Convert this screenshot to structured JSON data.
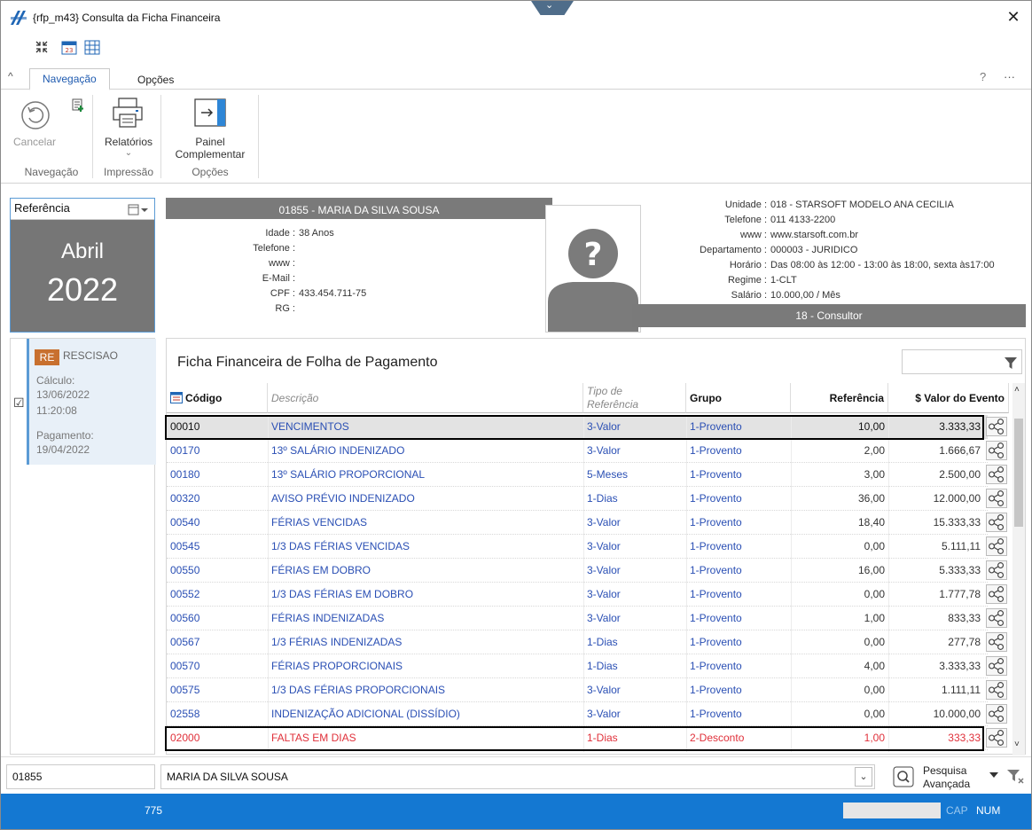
{
  "window": {
    "title": "{rfp_m43}  Consulta da Ficha Financeira",
    "close_glyph": "✕"
  },
  "ribbon": {
    "tabs": [
      {
        "label": "Navegação",
        "active": true
      },
      {
        "label": "Opções",
        "active": false
      }
    ],
    "help": "?",
    "more": "···",
    "buttons": {
      "cancel": "Cancelar",
      "reports": "Relatórios",
      "reports_arrow": "⌄",
      "panel_line1": "Painel",
      "panel_line2": "Complementar"
    },
    "groups": {
      "nav": "Navegação",
      "print": "Impressão",
      "options": "Opções"
    }
  },
  "reference": {
    "label": "Referência",
    "month": "Abril",
    "year": "2022"
  },
  "employee": {
    "header": "01855 - MARIA DA SILVA SOUSA",
    "left_labels": [
      "Idade :",
      "Telefone :",
      "www :",
      "E-Mail :",
      "CPF :",
      "RG :"
    ],
    "left_values": [
      "38 Anos",
      "",
      "",
      "",
      "433.454.711-75",
      ""
    ],
    "right_labels": [
      "Unidade :",
      "Telefone :",
      "www :",
      "Departamento :",
      "Horário :",
      "Regime :",
      "Salário :"
    ],
    "right_values": [
      "018 - STARSOFT MODELO ANA CECILIA",
      "011 4133-2200",
      "www.starsoft.com.br",
      "000003 - JURIDICO",
      "Das 08:00 às 12:00 - 13:00 às 18:00, sexta às17:00",
      "1-CLT",
      "10.000,00 / Mês"
    ],
    "role": "18 - Consultor"
  },
  "calc": {
    "badge": "RE",
    "type": "RESCISAO",
    "calc_label": "Cálculo:",
    "calc_date": "13/06/2022",
    "calc_time": "11:20:08",
    "pay_label": "Pagamento:",
    "pay_date": "19/04/2022",
    "check": "☑"
  },
  "grid": {
    "title": "Ficha Financeira de Folha de Pagamento",
    "headers": {
      "code": "Código",
      "desc": "Descrição",
      "tipo1": "Tipo de",
      "tipo2": "Referência",
      "grupo": "Grupo",
      "ref": "Referência",
      "valor": "$ Valor do Evento"
    },
    "rows": [
      {
        "code": "00010",
        "desc": "VENCIMENTOS",
        "tipo": "3-Valor",
        "grupo": "1-Provento",
        "ref": "10,00",
        "valor": "3.333,33"
      },
      {
        "code": "00170",
        "desc": "13º SALÁRIO INDENIZADO",
        "tipo": "3-Valor",
        "grupo": "1-Provento",
        "ref": "2,00",
        "valor": "1.666,67"
      },
      {
        "code": "00180",
        "desc": "13º SALÁRIO PROPORCIONAL",
        "tipo": "5-Meses",
        "grupo": "1-Provento",
        "ref": "3,00",
        "valor": "2.500,00"
      },
      {
        "code": "00320",
        "desc": "AVISO PRÉVIO INDENIZADO",
        "tipo": "1-Dias",
        "grupo": "1-Provento",
        "ref": "36,00",
        "valor": "12.000,00"
      },
      {
        "code": "00540",
        "desc": "FÉRIAS VENCIDAS",
        "tipo": "3-Valor",
        "grupo": "1-Provento",
        "ref": "18,40",
        "valor": "15.333,33"
      },
      {
        "code": "00545",
        "desc": "1/3 DAS FÉRIAS VENCIDAS",
        "tipo": "3-Valor",
        "grupo": "1-Provento",
        "ref": "0,00",
        "valor": "5.111,11"
      },
      {
        "code": "00550",
        "desc": "FÉRIAS EM DOBRO",
        "tipo": "3-Valor",
        "grupo": "1-Provento",
        "ref": "16,00",
        "valor": "5.333,33"
      },
      {
        "code": "00552",
        "desc": "1/3 DAS FÉRIAS EM DOBRO",
        "tipo": "3-Valor",
        "grupo": "1-Provento",
        "ref": "0,00",
        "valor": "1.777,78"
      },
      {
        "code": "00560",
        "desc": "FÉRIAS INDENIZADAS",
        "tipo": "3-Valor",
        "grupo": "1-Provento",
        "ref": "1,00",
        "valor": "833,33"
      },
      {
        "code": "00567",
        "desc": "1/3 FÉRIAS INDENIZADAS",
        "tipo": "1-Dias",
        "grupo": "1-Provento",
        "ref": "0,00",
        "valor": "277,78"
      },
      {
        "code": "00570",
        "desc": "FÉRIAS PROPORCIONAIS",
        "tipo": "1-Dias",
        "grupo": "1-Provento",
        "ref": "4,00",
        "valor": "3.333,33"
      },
      {
        "code": "00575",
        "desc": "1/3 DAS FÉRIAS PROPORCIONAIS",
        "tipo": "3-Valor",
        "grupo": "1-Provento",
        "ref": "0,00",
        "valor": "1.111,11"
      },
      {
        "code": "02558",
        "desc": "INDENIZAÇÃO ADICIONAL (DISSÍDIO)",
        "tipo": "3-Valor",
        "grupo": "1-Provento",
        "ref": "0,00",
        "valor": "10.000,00"
      },
      {
        "code": "02000",
        "desc": "FALTAS EM DIAS",
        "tipo": "1-Dias",
        "grupo": "2-Desconto",
        "ref": "1,00",
        "valor": "333,33"
      }
    ]
  },
  "search": {
    "code": "01855",
    "name": "MARIA DA SILVA SOUSA",
    "adv1": "Pesquisa",
    "adv2": "Avançada"
  },
  "status": {
    "count": "775",
    "cap": "CAP",
    "num": "NUM"
  },
  "colors": {
    "provento": "#2a4fb4",
    "desconto": "#e0303a",
    "statusbar": "#1478d2"
  }
}
